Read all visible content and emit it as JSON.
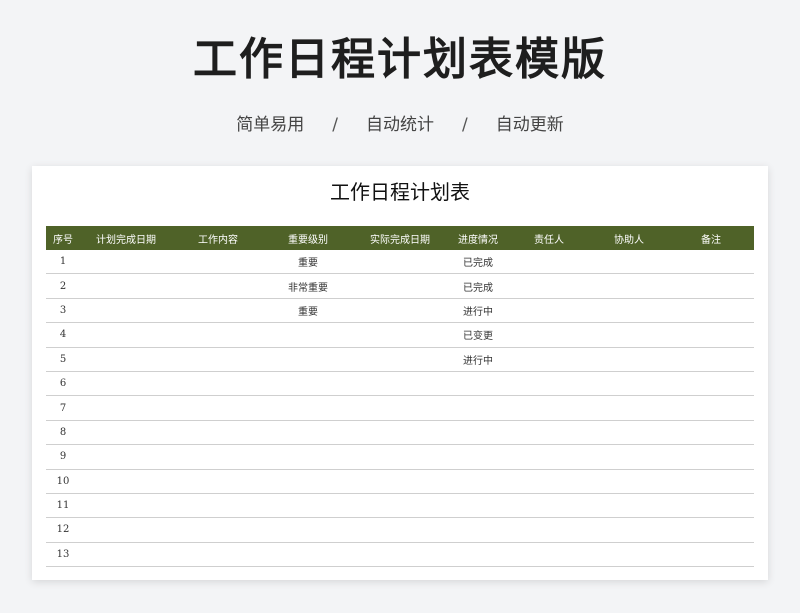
{
  "banner": {
    "title": "工作日程计划表模版",
    "tagline": [
      "简单易用",
      "自动统计",
      "自动更新"
    ],
    "separator": "/"
  },
  "sheet": {
    "title": "工作日程计划表",
    "header_color": "#4f6228",
    "columns": [
      "序号",
      "计划完成日期",
      "工作内容",
      "重要级别",
      "实际完成日期",
      "进度情况",
      "责任人",
      "协助人",
      "备注"
    ],
    "rows": [
      {
        "idx": "1",
        "plan_date": "",
        "work": "",
        "level": "重要",
        "actual_date": "",
        "progress": "已完成",
        "owner": "",
        "assist": "",
        "note": ""
      },
      {
        "idx": "2",
        "plan_date": "",
        "work": "",
        "level": "非常重要",
        "actual_date": "",
        "progress": "已完成",
        "owner": "",
        "assist": "",
        "note": ""
      },
      {
        "idx": "3",
        "plan_date": "",
        "work": "",
        "level": "重要",
        "actual_date": "",
        "progress": "进行中",
        "owner": "",
        "assist": "",
        "note": ""
      },
      {
        "idx": "4",
        "plan_date": "",
        "work": "",
        "level": "",
        "actual_date": "",
        "progress": "已变更",
        "owner": "",
        "assist": "",
        "note": ""
      },
      {
        "idx": "5",
        "plan_date": "",
        "work": "",
        "level": "",
        "actual_date": "",
        "progress": "进行中",
        "owner": "",
        "assist": "",
        "note": ""
      },
      {
        "idx": "6",
        "plan_date": "",
        "work": "",
        "level": "",
        "actual_date": "",
        "progress": "",
        "owner": "",
        "assist": "",
        "note": ""
      },
      {
        "idx": "7",
        "plan_date": "",
        "work": "",
        "level": "",
        "actual_date": "",
        "progress": "",
        "owner": "",
        "assist": "",
        "note": ""
      },
      {
        "idx": "8",
        "plan_date": "",
        "work": "",
        "level": "",
        "actual_date": "",
        "progress": "",
        "owner": "",
        "assist": "",
        "note": ""
      },
      {
        "idx": "9",
        "plan_date": "",
        "work": "",
        "level": "",
        "actual_date": "",
        "progress": "",
        "owner": "",
        "assist": "",
        "note": ""
      },
      {
        "idx": "10",
        "plan_date": "",
        "work": "",
        "level": "",
        "actual_date": "",
        "progress": "",
        "owner": "",
        "assist": "",
        "note": ""
      },
      {
        "idx": "11",
        "plan_date": "",
        "work": "",
        "level": "",
        "actual_date": "",
        "progress": "",
        "owner": "",
        "assist": "",
        "note": ""
      },
      {
        "idx": "12",
        "plan_date": "",
        "work": "",
        "level": "",
        "actual_date": "",
        "progress": "",
        "owner": "",
        "assist": "",
        "note": ""
      },
      {
        "idx": "13",
        "plan_date": "",
        "work": "",
        "level": "",
        "actual_date": "",
        "progress": "",
        "owner": "",
        "assist": "",
        "note": ""
      }
    ]
  }
}
